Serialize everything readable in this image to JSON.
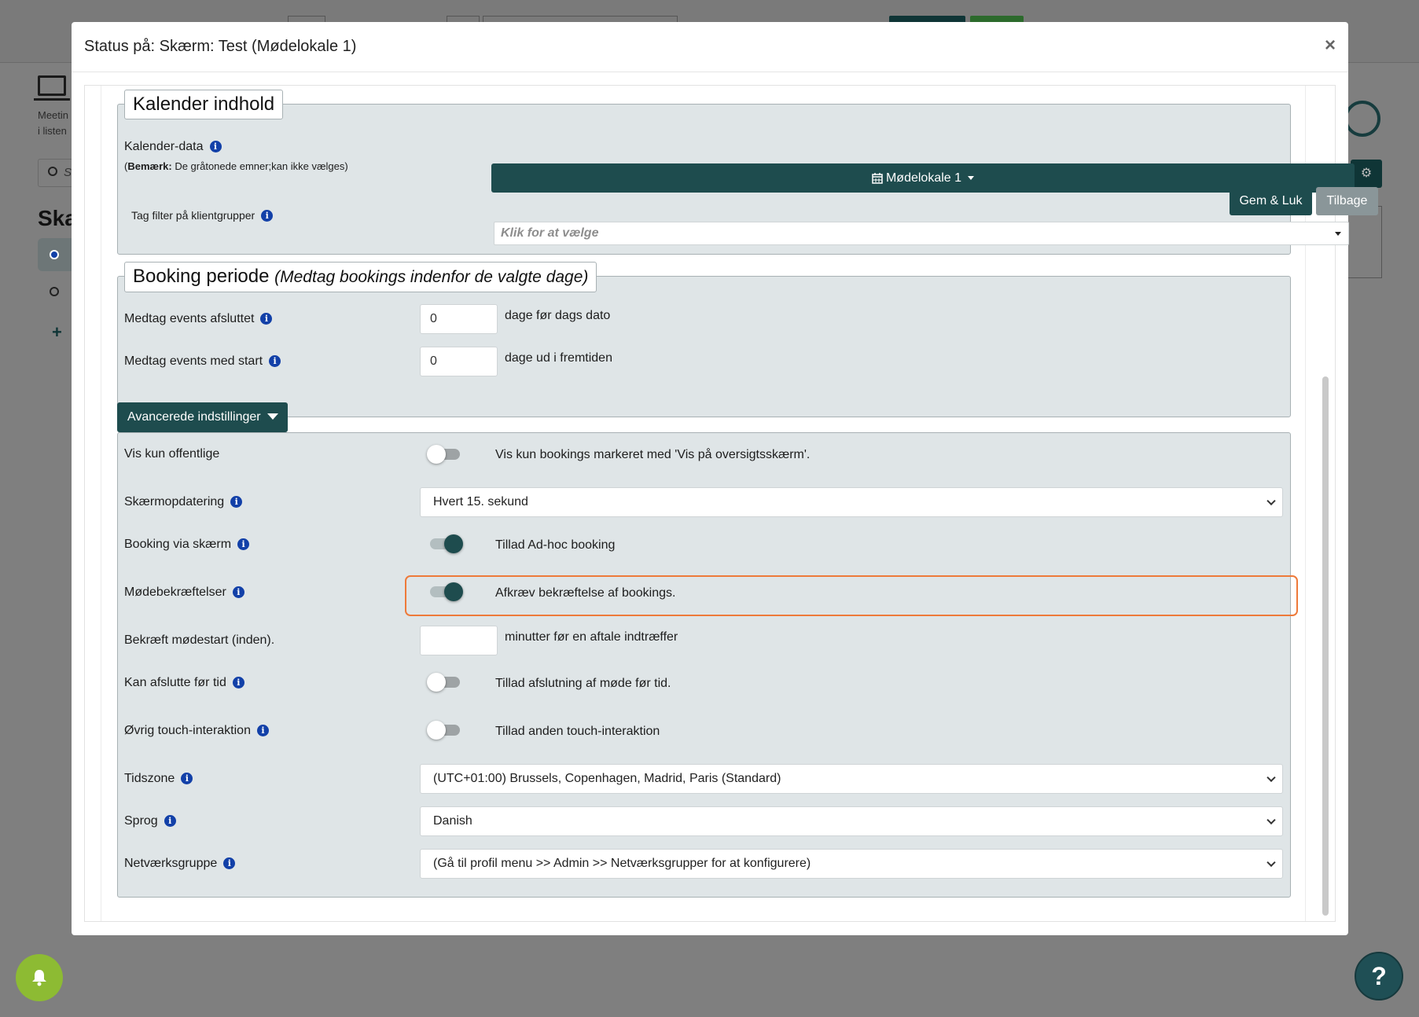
{
  "background": {
    "left_small_text_1": "Meetin",
    "left_small_text_2": "i listen",
    "left_search_placeholder": "S",
    "left_heading": "Ska",
    "right_gear_icon": "gear-icon"
  },
  "modal": {
    "title": "Status på: Skærm: Test (Mødelokale 1)",
    "close_label": "×"
  },
  "calendar_section": {
    "legend": "Kalender indhold",
    "calendar_data_label": "Kalender-data",
    "note_bold": "Bemærk:",
    "note_prefix": "(",
    "note_text": " De gråtonede emner;kan ikke vælges)",
    "calendar_button_label": "Mødelokale 1",
    "tag_filter_label": "Tag filter på klientgrupper",
    "tag_filter_placeholder": "Klik for at vælge"
  },
  "tooltips": {
    "save_close": "Gem & Luk",
    "back": "Tilbage"
  },
  "booking_section": {
    "legend_main": "Booking periode",
    "legend_italic": "(Medtag bookings indenfor de valgte dage)",
    "ended_label": "Medtag events afsluttet",
    "ended_value": "0",
    "ended_suffix": "dage før dags dato",
    "start_label": "Medtag events med start",
    "start_value": "0",
    "start_suffix": "dage ud i fremtiden"
  },
  "advanced": {
    "button_label": "Avancerede indstillinger",
    "rows": {
      "public_only": {
        "label": "Vis kun offentlige",
        "toggle": false,
        "text": "Vis kun bookings markeret med 'Vis på oversigtsskærm'."
      },
      "refresh": {
        "label": "Skærmopdatering",
        "value": "Hvert 15. sekund"
      },
      "booking_via_screen": {
        "label": "Booking via skærm",
        "toggle": true,
        "text": "Tillad Ad-hoc booking"
      },
      "meeting_confirm": {
        "label": "Mødebekræftelser",
        "toggle": true,
        "text": "Afkræv bekræftelse af bookings."
      },
      "confirm_start": {
        "label": "Bekræft mødestart (inden).",
        "value": "",
        "suffix": "minutter før en aftale indtræffer"
      },
      "end_early": {
        "label": "Kan afslutte før tid",
        "toggle": false,
        "text": "Tillad afslutning af møde før tid."
      },
      "touch": {
        "label": "Øvrig touch-interaktion",
        "toggle": false,
        "text": "Tillad anden touch-interaktion"
      },
      "timezone": {
        "label": "Tidszone",
        "value": "(UTC+01:00) Brussels, Copenhagen, Madrid, Paris (Standard)"
      },
      "language": {
        "label": "Sprog",
        "value": "Danish"
      },
      "network_group": {
        "label": "Netværksgruppe",
        "value": "(Gå til profil menu >> Admin >> Netværksgrupper for at konfigurere)"
      }
    }
  },
  "floating": {
    "help_label": "?"
  },
  "colors": {
    "primary": "#1e4c4e",
    "highlight": "#ee7a3a",
    "info_icon": "#1240a8",
    "notification": "#8dbb33",
    "section_bg": "#dfe5e7"
  }
}
